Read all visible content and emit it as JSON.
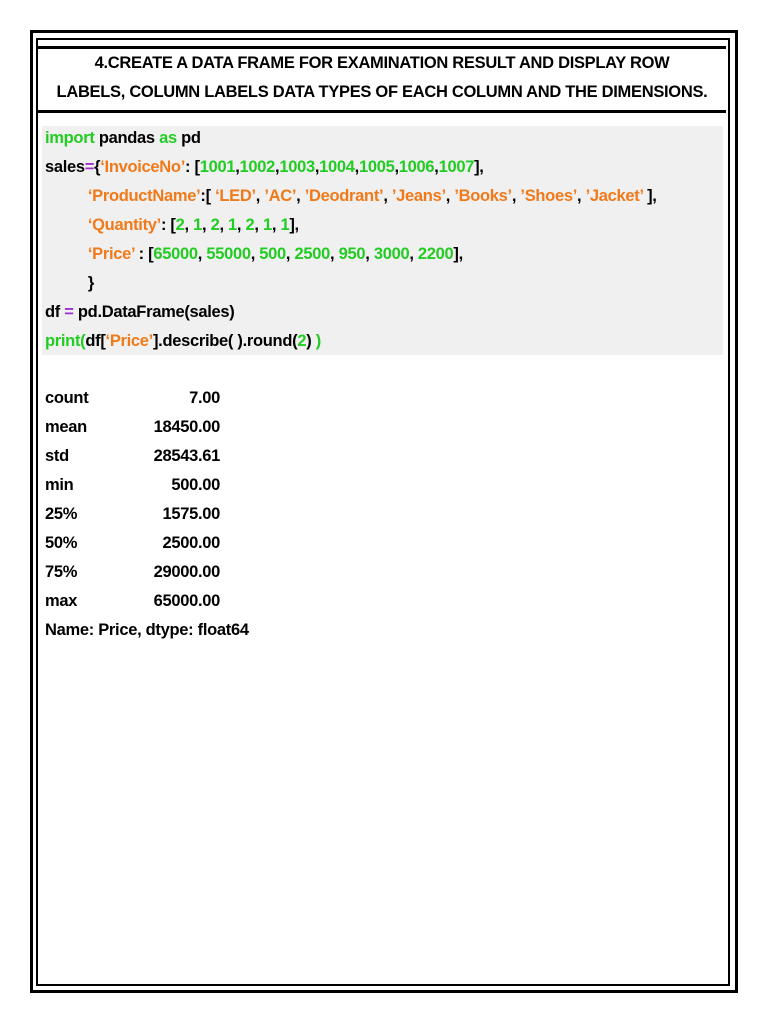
{
  "title": [
    "4.CREATE A DATA FRAME FOR EXAMINATION RESULT AND DISPLAY ROW",
    "LABELS, COLUMN LABELS DATA TYPES OF EACH COLUMN AND THE DIMENSIONS."
  ],
  "code_lines": [
    [
      [
        "g",
        "import"
      ],
      [
        "k",
        " pandas "
      ],
      [
        "g",
        "as"
      ],
      [
        "k",
        " pd"
      ]
    ],
    [
      [
        "k",
        "sales"
      ],
      [
        "p",
        "="
      ],
      [
        "k",
        "{"
      ],
      [
        "o",
        "‘InvoiceNo’"
      ],
      [
        "k",
        ": ["
      ],
      [
        "g",
        "1001"
      ],
      [
        "k",
        ","
      ],
      [
        "g",
        "1002"
      ],
      [
        "k",
        ","
      ],
      [
        "g",
        "1003"
      ],
      [
        "k",
        ","
      ],
      [
        "g",
        "1004"
      ],
      [
        "k",
        ","
      ],
      [
        "g",
        "1005"
      ],
      [
        "k",
        ","
      ],
      [
        "g",
        "1006"
      ],
      [
        "k",
        ","
      ],
      [
        "g",
        "1007"
      ],
      [
        "k",
        "],"
      ]
    ],
    [
      [
        "k",
        "          "
      ],
      [
        "o",
        "‘ProductName’"
      ],
      [
        "k",
        ":[ "
      ],
      [
        "o",
        "‘LED’"
      ],
      [
        "k",
        ", "
      ],
      [
        "o",
        "’AC’"
      ],
      [
        "k",
        ", "
      ],
      [
        "o",
        "’Deodrant’"
      ],
      [
        "k",
        ", "
      ],
      [
        "o",
        "’Jeans’"
      ],
      [
        "k",
        ", "
      ],
      [
        "o",
        "’Books’"
      ],
      [
        "k",
        ", "
      ],
      [
        "o",
        "’Shoes’"
      ],
      [
        "k",
        ", "
      ],
      [
        "o",
        "’Jacket’"
      ],
      [
        "k",
        " ],"
      ]
    ],
    [
      [
        "k",
        "          "
      ],
      [
        "o",
        "‘Quantity’"
      ],
      [
        "k",
        ": ["
      ],
      [
        "g",
        "2"
      ],
      [
        "k",
        ", "
      ],
      [
        "g",
        "1"
      ],
      [
        "k",
        ", "
      ],
      [
        "g",
        "2"
      ],
      [
        "k",
        ", "
      ],
      [
        "g",
        "1"
      ],
      [
        "k",
        ", "
      ],
      [
        "g",
        "2"
      ],
      [
        "k",
        ", "
      ],
      [
        "g",
        "1"
      ],
      [
        "k",
        ", "
      ],
      [
        "g",
        "1"
      ],
      [
        "k",
        "],"
      ]
    ],
    [
      [
        "k",
        "          "
      ],
      [
        "o",
        "‘Price’"
      ],
      [
        "k",
        " : ["
      ],
      [
        "g",
        "65000"
      ],
      [
        "k",
        ", "
      ],
      [
        "g",
        "55000"
      ],
      [
        "k",
        ", "
      ],
      [
        "g",
        "500"
      ],
      [
        "k",
        ", "
      ],
      [
        "g",
        "2500"
      ],
      [
        "k",
        ", "
      ],
      [
        "g",
        "950"
      ],
      [
        "k",
        ", "
      ],
      [
        "g",
        "3000"
      ],
      [
        "k",
        ", "
      ],
      [
        "g",
        "2200"
      ],
      [
        "k",
        "],"
      ]
    ],
    [
      [
        "k",
        "          }"
      ]
    ],
    [
      [
        "k",
        "df "
      ],
      [
        "p",
        "="
      ],
      [
        "k",
        " pd.DataFrame(sales)"
      ]
    ],
    [
      [
        "g",
        "print("
      ],
      [
        "k",
        "df["
      ],
      [
        "o",
        "‘Price’"
      ],
      [
        "k",
        "].describe( ).round("
      ],
      [
        "g",
        "2"
      ],
      [
        "k",
        ") "
      ],
      [
        "g",
        ")"
      ]
    ]
  ],
  "output": {
    "rows": [
      {
        "label": "count",
        "value": "7.00"
      },
      {
        "label": "mean",
        "value": "18450.00"
      },
      {
        "label": "std",
        "value": "28543.61"
      },
      {
        "label": "min",
        "value": "500.00"
      },
      {
        "label": "25%",
        "value": "1575.00"
      },
      {
        "label": "50%",
        "value": "2500.00"
      },
      {
        "label": "75%",
        "value": "29000.00"
      },
      {
        "label": "max",
        "value": "65000.00"
      }
    ],
    "footer": "Name:  Price,  dtype:  float64"
  }
}
